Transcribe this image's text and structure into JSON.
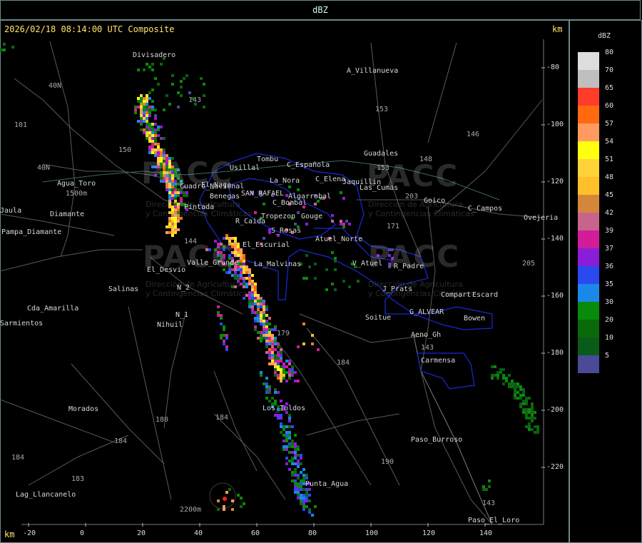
{
  "window": {
    "title": "dBZ"
  },
  "header": {
    "timestamp": "2026/02/18 08:14:00 UTC Composite",
    "unit_top": "km",
    "unit_bottom": "km"
  },
  "x_ticks": [
    "-20",
    "0",
    "20",
    "40",
    "60",
    "80",
    "100",
    "120",
    "140"
  ],
  "y_ticks": [
    "-80",
    "-100",
    "-120",
    "-140",
    "-160",
    "-180",
    "-200",
    "-220"
  ],
  "places": [
    "Divisadero",
    "A_Villanueva",
    "Agua_Toro",
    "Pampa_Diamante",
    "Jaula",
    "Usillal",
    "Tombu",
    "C_Española",
    "C_Elena",
    "La_Nora",
    "Jaquillin",
    "Las_Cumas",
    "Guadales",
    "Goico",
    "C_Campos",
    "Ovejeria",
    "SAN_RAFAEL",
    "Algarrobal",
    "Benegas",
    "El_Nago",
    "Cuadro_Nacional",
    "Pintada",
    "C_Bombal",
    "Tropezon",
    "Gouge",
    "R_Caida",
    "S_Rosas",
    "El_Escurial",
    "Atuel_Norte",
    "La_Malvinas",
    "Valle_Grande",
    "El_Desvio",
    "Salinas",
    "N_1",
    "N_2",
    "Nihuil",
    "Cda_Amarilla",
    "Sarmientos",
    "V_Atuel",
    "R_Padre",
    "J_Prats",
    "Compart",
    "Escard",
    "G_ALVEAR",
    "Bowen",
    "Soitue",
    "Aeno_Gh",
    "Carmensa",
    "Los_Toldos",
    "Morados",
    "Paso_Burroso",
    "Punta_Agua",
    "Lag_Llancanelo",
    "Paso_El_Loro",
    "Diamante"
  ],
  "routes": [
    "40N",
    "101",
    "40N",
    "150",
    "144",
    "143",
    "153",
    "146",
    "148",
    "153",
    "203",
    "171",
    "179",
    "184",
    "180",
    "184",
    "183",
    "184",
    "190",
    "143",
    "143",
    "205"
  ],
  "elevations": [
    "1500m",
    "2200m"
  ],
  "watermark": {
    "logo": "PACC",
    "line1": "Dirección de Agricultura",
    "line2": "y Contingencias Climáticas",
    "url": "http://www.contingencias.mendoza.gov.ar"
  },
  "legend": {
    "title": "dBZ",
    "levels": [
      {
        "label": "80",
        "color": "#dddddd"
      },
      {
        "label": "70",
        "color": "#bfbfbf"
      },
      {
        "label": "65",
        "color": "#ff3b2a"
      },
      {
        "label": "60",
        "color": "#ff6a10"
      },
      {
        "label": "57",
        "color": "#ff9a60"
      },
      {
        "label": "54",
        "color": "#ffff10"
      },
      {
        "label": "51",
        "color": "#ffd23a"
      },
      {
        "label": "48",
        "color": "#ffc02a"
      },
      {
        "label": "45",
        "color": "#d4873a"
      },
      {
        "label": "42",
        "color": "#c8648c"
      },
      {
        "label": "39",
        "color": "#d21c9a"
      },
      {
        "label": "37",
        "color": "#8a1ed8"
      },
      {
        "label": "36",
        "color": "#2a4af0"
      },
      {
        "label": "35",
        "color": "#1a88e8"
      },
      {
        "label": "30",
        "color": "#0a8a0a"
      },
      {
        "label": "20",
        "color": "#0a6a0a"
      },
      {
        "label": "10",
        "color": "#0a5a1a"
      },
      {
        "label": "5",
        "color": "#4a4a98"
      }
    ]
  }
}
